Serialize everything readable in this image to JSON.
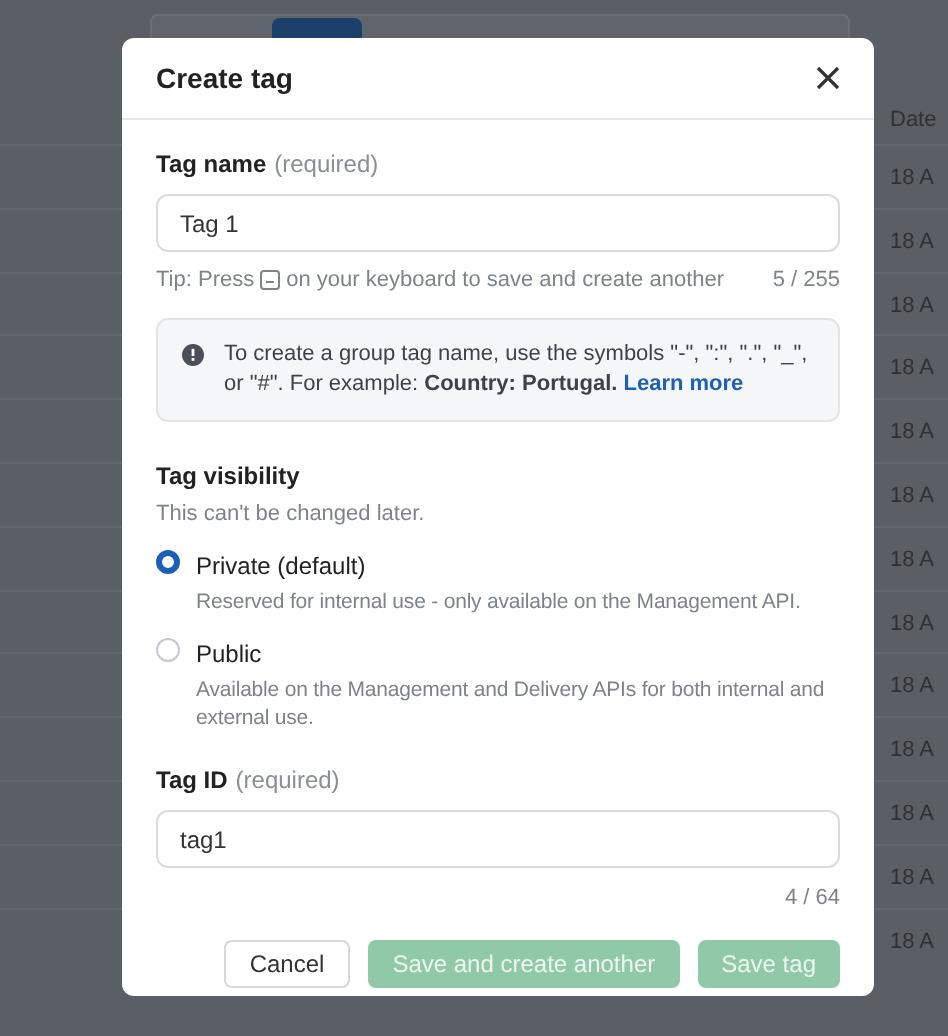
{
  "background_table": {
    "column_header": "Date",
    "cells": [
      "18 A",
      "18 A",
      "18 A",
      "18 A",
      "18 A",
      "18 A",
      "18 A",
      "18 A",
      "18 A",
      "18 A",
      "18 A",
      "18 A",
      "18 A"
    ]
  },
  "dialog": {
    "title": "Create tag",
    "tag_name": {
      "label": "Tag name",
      "hint": "(required)",
      "value": "Tag 1",
      "tip_before": "Tip: Press",
      "tip_after": "on your keyboard to save and create another",
      "counter": "5 / 255"
    },
    "info": {
      "text": "To create a group tag name, use the symbols \"-\", \":\", \".\", \"_\", or \"#\". For example: **Country: Portugal.**",
      "link": "Learn more"
    },
    "visibility": {
      "label": "Tag visibility",
      "note": "This can't be changed later.",
      "options": [
        {
          "label": "Private (default)",
          "description": "Reserved for internal use - only available on the Management API.",
          "selected": true
        },
        {
          "label": "Public",
          "description": "Available on the Management and Delivery APIs for both internal and external use.",
          "selected": false
        }
      ]
    },
    "tag_id": {
      "label": "Tag ID",
      "hint": "(required)",
      "value": "tag1",
      "counter": "4 / 64"
    },
    "buttons": [
      {
        "label": "Cancel",
        "kind": "secondary",
        "disabled": false
      },
      {
        "label": "Save and create another",
        "kind": "primary",
        "disabled": true
      },
      {
        "label": "Save tag",
        "kind": "primary",
        "disabled": true
      }
    ]
  }
}
